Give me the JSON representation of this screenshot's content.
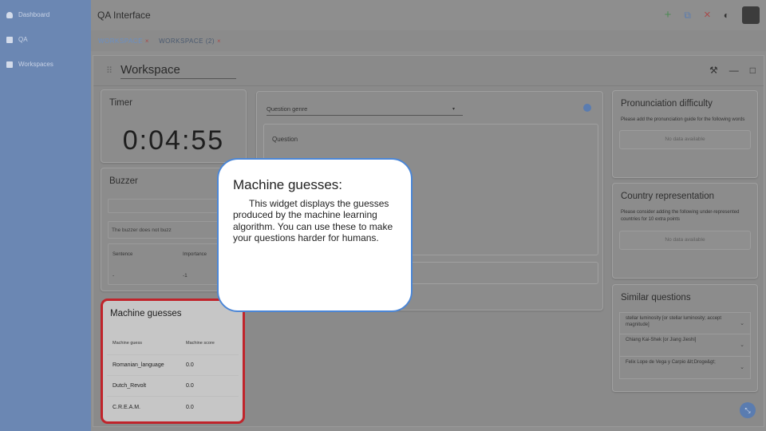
{
  "sidebar": {
    "items": [
      {
        "label": "Dashboard",
        "icon": "person-icon"
      },
      {
        "label": "QA",
        "icon": "document-icon"
      },
      {
        "label": "Workspaces",
        "icon": "grid-icon"
      }
    ]
  },
  "header": {
    "title": "QA Interface",
    "tools": {
      "plus": "+",
      "windows": "⧉",
      "close": "×",
      "brightness": "◐"
    }
  },
  "tabs": [
    {
      "label": "WORKSPACE",
      "close": "×"
    },
    {
      "label": "WORKSPACE (2)",
      "close": "×"
    }
  ],
  "workspace": {
    "title": "Workspace",
    "tools": {
      "tools": "⚒",
      "minimize": "—",
      "maximize": "□"
    }
  },
  "timer": {
    "title": "Timer",
    "value": "0:04:55"
  },
  "buzzer": {
    "title": "Buzzer",
    "message": "The buzzer does not buzz",
    "columns": [
      "Sentence",
      "Importance"
    ],
    "rows": [
      [
        "-",
        "-1"
      ]
    ]
  },
  "machine_guesses": {
    "title": "Machine guesses",
    "columns": [
      "Machine guess",
      "Machine score"
    ],
    "rows": [
      [
        "Romanian_language",
        "0.0"
      ],
      [
        "Dutch_Revolt",
        "0.0"
      ],
      [
        "C.R.E.A.M.",
        "0.0"
      ]
    ]
  },
  "question": {
    "genre_placeholder": "Question genre",
    "genre_arrow": "▾",
    "question_label": "Question"
  },
  "pronunciation": {
    "title": "Pronunciation difficulty",
    "desc": "Please add the pronunciation guide for the following words",
    "nodata": "No data available"
  },
  "country": {
    "title": "Country representation",
    "desc": "Please consider adding the following under-represented countries for 10 extra points",
    "nodata": "No data available"
  },
  "similar": {
    "title": "Similar questions",
    "chevron": "⌄",
    "items": [
      "stellar luminosity [or stellar luminosity; accept magnitude]",
      "Chiang Kai-Shek [or Jiang Jieshi]",
      "Felix Lope de Vega y Carpio &lt;Droge&gt;"
    ]
  },
  "fab": {
    "icon": "⤡"
  },
  "tooltip": {
    "title": "Machine guesses:",
    "body": "This widget displays the guesses produced by the machine learning algorithm. You can use these to make your questions harder for humans."
  }
}
